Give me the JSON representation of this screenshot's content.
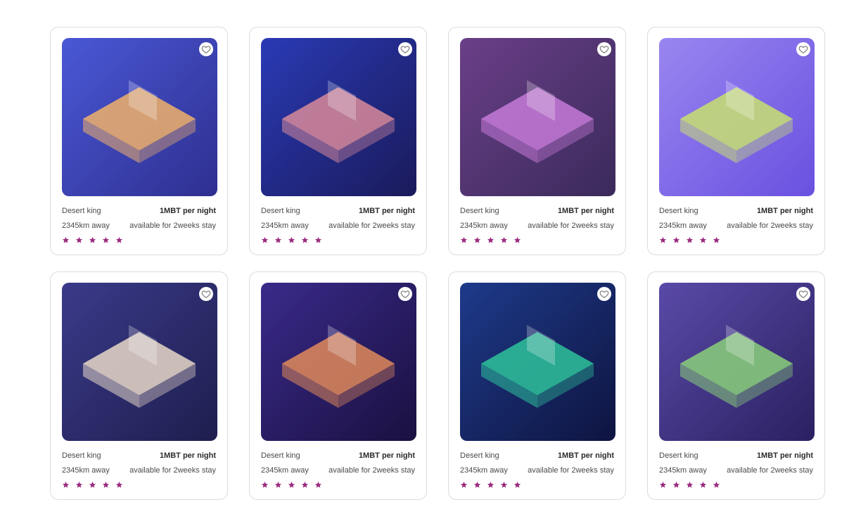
{
  "listings": [
    {
      "name": "Desert king",
      "price": "1MBT per night",
      "distance": "2345km away",
      "availability": "available for 2weeks stay",
      "rating": 5,
      "bg": [
        "#4a58d6",
        "#2e2f8f"
      ],
      "accent": "#f0b06a"
    },
    {
      "name": "Desert king",
      "price": "1MBT per night",
      "distance": "2345km away",
      "availability": "available for 2weeks stay",
      "rating": 5,
      "bg": [
        "#2a3ab5",
        "#1a1a5a"
      ],
      "accent": "#d88a9a"
    },
    {
      "name": "Desert king",
      "price": "1MBT per night",
      "distance": "2345km away",
      "availability": "available for 2weeks stay",
      "rating": 5,
      "bg": [
        "#6a3f88",
        "#3a2a5a"
      ],
      "accent": "#c67ad8"
    },
    {
      "name": "Desert king",
      "price": "1MBT per night",
      "distance": "2345km away",
      "availability": "available for 2weeks stay",
      "rating": 5,
      "bg": [
        "#9a86f0",
        "#6a50e0"
      ],
      "accent": "#c7e070"
    },
    {
      "name": "Desert king",
      "price": "1MBT per night",
      "distance": "2345km away",
      "availability": "available for 2weeks stay",
      "rating": 5,
      "bg": [
        "#3a3a8a",
        "#1e1e4e"
      ],
      "accent": "#e8d8c8"
    },
    {
      "name": "Desert king",
      "price": "1MBT per night",
      "distance": "2345km away",
      "availability": "available for 2weeks stay",
      "rating": 5,
      "bg": [
        "#3a2a8a",
        "#1a1040"
      ],
      "accent": "#e08a5a"
    },
    {
      "name": "Desert king",
      "price": "1MBT per night",
      "distance": "2345km away",
      "availability": "available for 2weeks stay",
      "rating": 5,
      "bg": [
        "#1e3a8a",
        "#0e1440"
      ],
      "accent": "#2ec29a"
    },
    {
      "name": "Desert king",
      "price": "1MBT per night",
      "distance": "2345km away",
      "availability": "available for 2weeks stay",
      "rating": 5,
      "bg": [
        "#5a4aa8",
        "#2a2060"
      ],
      "accent": "#8ad07a"
    }
  ],
  "icons": {
    "favorite": "heart-icon",
    "rating": "star-icon"
  },
  "colors": {
    "star": "#9b2a7e",
    "card_border": "#dcdcdc",
    "heart_outline": "#7a7a7a"
  }
}
